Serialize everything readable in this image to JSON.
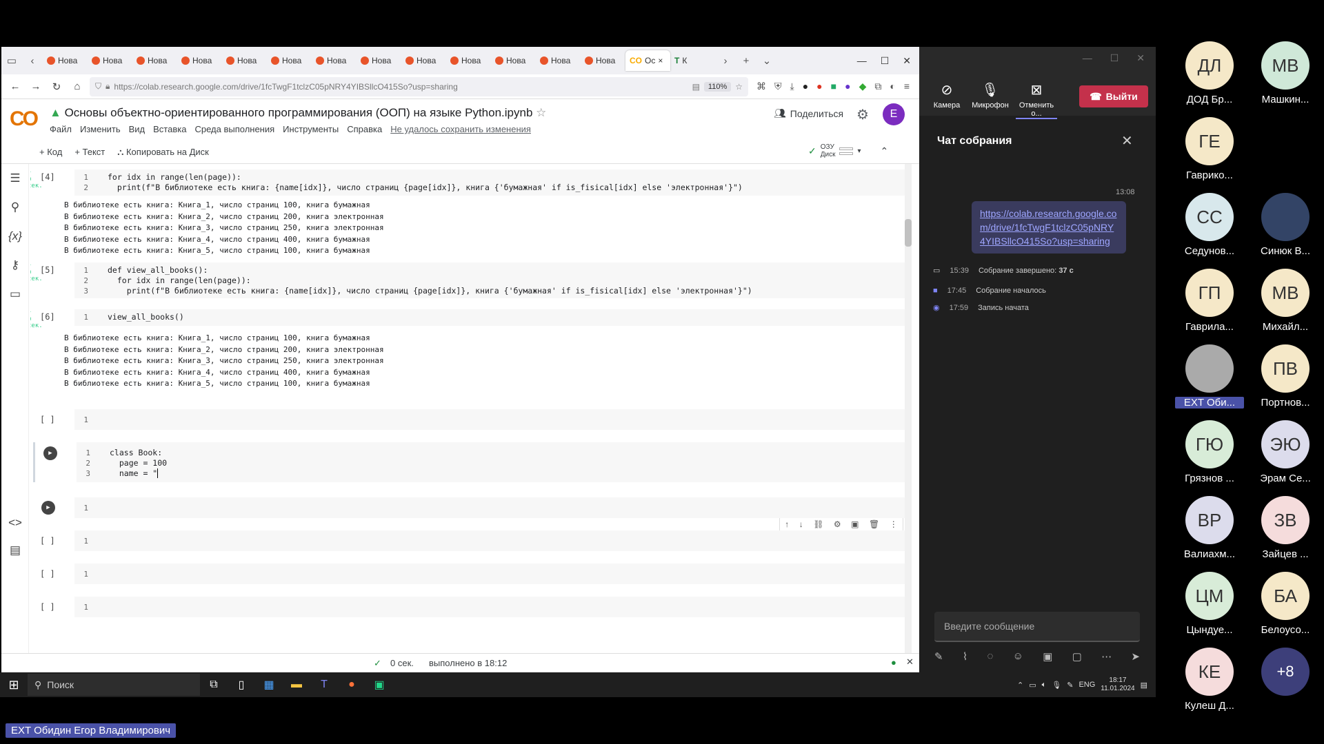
{
  "browser": {
    "tabs": [
      "Нова",
      "Нова",
      "Нова",
      "Нова",
      "Нова",
      "Нова",
      "Нова",
      "Нова",
      "Нова",
      "Нова",
      "Нова",
      "Нова",
      "Нова"
    ],
    "active_tab": "Ос",
    "extra_tab": "К",
    "url": "https://colab.research.google.com/drive/1fcTwgF1tclzC05pNRY4YIBSllcO415So?usp=sharing",
    "zoom": "110%"
  },
  "colab": {
    "logo": "CO",
    "title": "Основы объектно-ориентированного программирования (ООП) на языке Python.ipynb",
    "menu": [
      "Файл",
      "Изменить",
      "Вид",
      "Вставка",
      "Среда выполнения",
      "Инструменты",
      "Справка"
    ],
    "save_warning": "Не удалось сохранить изменения",
    "share_label": "Поделиться",
    "user_initial": "E",
    "toolbar": {
      "add_code": "+ Код",
      "add_text": "+ Текст",
      "copy_drive": "Копировать на Диск"
    },
    "resources": {
      "ram": "ОЗУ",
      "disk": "Диск"
    },
    "status": {
      "time": "0 сек.",
      "done": "выполнено в 18:12"
    }
  },
  "cells": {
    "c4": {
      "exec": "[4]",
      "line1": "for idx in range(len(page)):",
      "line2": "  print(f\"В библиотеке есть книга: {name[idx]}, число страниц {page[idx]}, книга {'бумажная' if is_fisical[idx] else 'электронная'}\")",
      "output": "В библиотеке есть книга: Книга_1, число страниц 100, книга бумажная\nВ библиотеке есть книга: Книга_2, число страниц 200, книга электронная\nВ библиотеке есть книга: Книга_3, число страниц 250, книга электронная\nВ библиотеке есть книга: Книга_4, число страниц 400, книга бумажная\nВ библиотеке есть книга: Книга_5, число страниц 100, книга бумажная"
    },
    "c5": {
      "exec": "[5]",
      "line1": "def view_all_books():",
      "line2": "  for idx in range(len(page)):",
      "line3": "    print(f\"В библиотеке есть книга: {name[idx]}, число страниц {page[idx]}, книга {'бумажная' if is_fisical[idx] else 'электронная'}\")"
    },
    "c6": {
      "exec": "[6]",
      "line1": "view_all_books()",
      "output": "В библиотеке есть книга: Книга_1, число страниц 100, книга бумажная\nВ библиотеке есть книга: Книга_2, число страниц 200, книга электронная\nВ библиотеке есть книга: Книга_3, число страниц 250, книга электронная\nВ библиотеке есть книга: Книга_4, число страниц 400, книга бумажная\nВ библиотеке есть книга: Книга_5, число страниц 100, книга бумажная"
    },
    "empty_exec": "[ ]",
    "book": {
      "line1": "class Book:",
      "line2": "  page = 100",
      "line3": "  name = \""
    },
    "line_numbers": [
      "1",
      "2",
      "3"
    ]
  },
  "teams": {
    "camera": "Камера",
    "mic": "Микрофон",
    "cancel": "Отменить о...",
    "leave": "Выйти",
    "chat_title": "Чат собрания",
    "msg_time": "13:08",
    "msg_link": "https://colab.research.google.com/drive/1fcTwgF1tclzC05pNRY4YIBSllcO415So?usp=sharing",
    "events": [
      {
        "time": "15:39",
        "text": "Собрание завершено:",
        "extra": "37 с"
      },
      {
        "time": "17:45",
        "text": "Собрание началось",
        "extra": ""
      },
      {
        "time": "17:59",
        "text": "Запись начата",
        "extra": ""
      }
    ],
    "input_placeholder": "Введите сообщение"
  },
  "participants": [
    {
      "initials": "ДЛ",
      "name": "ДОД Бр...",
      "color": "#f5e8c8"
    },
    {
      "initials": "МВ",
      "name": "Машкин...",
      "color": "#cfe8d8"
    },
    {
      "initials": "ГЕ",
      "name": "Гаврико...",
      "color": "#f5e8c8"
    },
    {
      "initials": "",
      "name": "",
      "color": "#f5e8c8"
    },
    {
      "initials": "СС",
      "name": "Седунов...",
      "color": "#d8e8ec"
    },
    {
      "initials": "",
      "name": "Синюк В...",
      "color": "#334466"
    },
    {
      "initials": "ГП",
      "name": "Гаврила...",
      "color": "#f5e8c8"
    },
    {
      "initials": "МВ",
      "name": "Михайл...",
      "color": "#f5e8c8"
    },
    {
      "initials": "",
      "name": "EXT Оби...",
      "color": "#aaa"
    },
    {
      "initials": "ПВ",
      "name": "Портнов...",
      "color": "#f5e8c8"
    },
    {
      "initials": "ГЮ",
      "name": "Грязнов ...",
      "color": "#d8ecd8"
    },
    {
      "initials": "ЭЮ",
      "name": "Эрам Се...",
      "color": "#dcdcec"
    },
    {
      "initials": "ВР",
      "name": "Валиахм...",
      "color": "#dcdcec"
    },
    {
      "initials": "ЗВ",
      "name": "Зайцев ...",
      "color": "#f5dcdc"
    },
    {
      "initials": "ЦМ",
      "name": "Цындуе...",
      "color": "#d8ecd8"
    },
    {
      "initials": "БА",
      "name": "Белоусо...",
      "color": "#f5e8c8"
    },
    {
      "initials": "КЕ",
      "name": "Кулеш Д...",
      "color": "#f5dcdc"
    },
    {
      "initials": "+8",
      "name": "",
      "color": "#3d3f7a"
    }
  ],
  "speaker_label": "EXT Обидин Егор Владимирович",
  "taskbar": {
    "search": "Поиск",
    "lang": "ENG",
    "time": "18:17",
    "date": "11.01.2024"
  }
}
